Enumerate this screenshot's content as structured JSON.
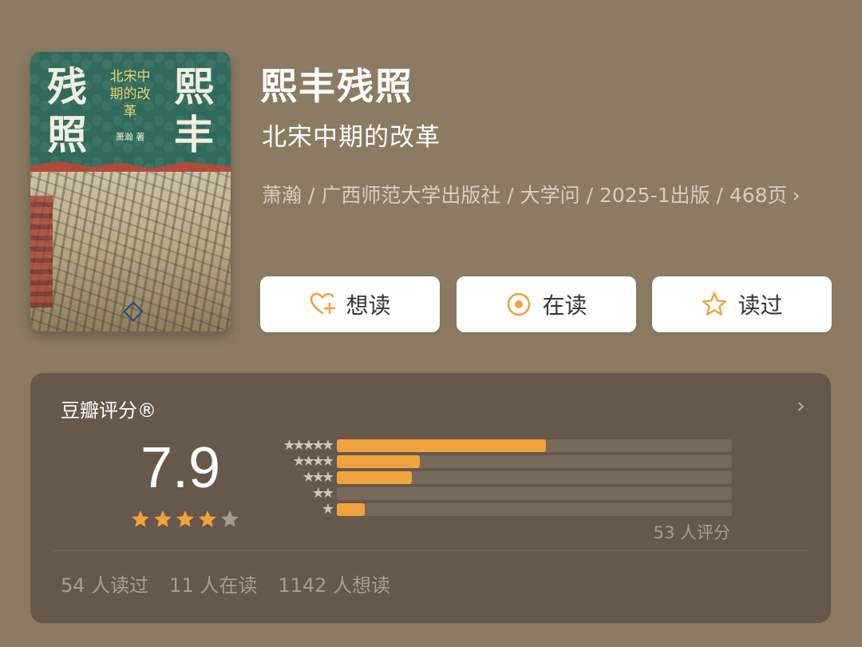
{
  "book": {
    "cover": {
      "title_left": "残照",
      "title_right": "熙丰",
      "subtitle": "北宋中期的改革",
      "author": "萧瀚 著"
    },
    "title": "熙丰残照",
    "subtitle": "北宋中期的改革",
    "meta": "萧瀚 / 广西师范大学出版社 / 大学问 / 2025-1出版 / 468页",
    "meta_chevron": "›"
  },
  "actions": {
    "want": {
      "label": "想读",
      "icon": "heart-plus-icon"
    },
    "reading": {
      "label": "在读",
      "icon": "target-icon"
    },
    "read": {
      "label": "读过",
      "icon": "star-outline-icon"
    }
  },
  "rating": {
    "title": "豆瓣评分®",
    "chevron": "›",
    "score": "7.9",
    "stars_filled": 4,
    "stars_total": 5,
    "distribution": [
      {
        "label": "★★★★★",
        "fraction": 0.53
      },
      {
        "label": "★★★★",
        "fraction": 0.21
      },
      {
        "label": "★★★",
        "fraction": 0.19
      },
      {
        "label": "★★",
        "fraction": 0.0
      },
      {
        "label": "★",
        "fraction": 0.07
      }
    ],
    "count_text": "53 人评分",
    "stats": {
      "read": "54 人读过",
      "reading": "11 人在读",
      "want": "1142 人想读"
    }
  },
  "colors": {
    "background": "#8b7b62",
    "card": "#66584a",
    "accent": "#f0a23c"
  }
}
